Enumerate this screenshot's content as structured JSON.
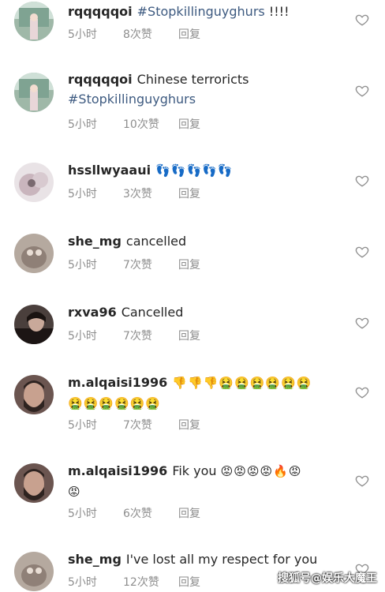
{
  "comments": [
    {
      "user": "rqqqqqoi",
      "text": "",
      "hashtag": "#Stopkillinguyghurs",
      "suffix": " !!!!",
      "time": "5小时",
      "likes": "8次赞",
      "reply": "回复"
    },
    {
      "user": "rqqqqqoi",
      "text": "Chinese terroricts",
      "hashtag": "#Stopkillinguyghurs",
      "time": "5小时",
      "likes": "10次赞",
      "reply": "回复"
    },
    {
      "user": "hssllwyaaui",
      "emoji": "👣👣👣👣👣",
      "time": "5小时",
      "likes": "3次赞",
      "reply": "回复"
    },
    {
      "user": "she_mg",
      "text": "cancelled",
      "time": "5小时",
      "likes": "7次赞",
      "reply": "回复"
    },
    {
      "user": "rxva96",
      "text": "Cancelled",
      "time": "5小时",
      "likes": "7次赞",
      "reply": "回复"
    },
    {
      "user": "m.alqaisi1996",
      "emoji_line1": "👎👎👎🤮🤮🤮🤮🤮🤮",
      "emoji_line2": "🤮🤮🤮🤮🤮🤮",
      "time": "5小时",
      "likes": "7次赞",
      "reply": "回复"
    },
    {
      "user": "m.alqaisi1996",
      "text": "Fik you",
      "emoji_line1": "😡😡😡😡🔥😡",
      "emoji_line2": "😡",
      "time": "5小时",
      "likes": "6次赞",
      "reply": "回复"
    },
    {
      "user": "she_mg",
      "text": "I've lost all my respect for you",
      "time": "5小时",
      "likes": "12次赞",
      "reply": "回复"
    }
  ],
  "watermark": "搜狐号@娱乐大魔王",
  "icons": {
    "like": "heart-outline-icon"
  },
  "colors": {
    "hashtag": "#3d5a80",
    "meta": "#8e8e8e"
  }
}
